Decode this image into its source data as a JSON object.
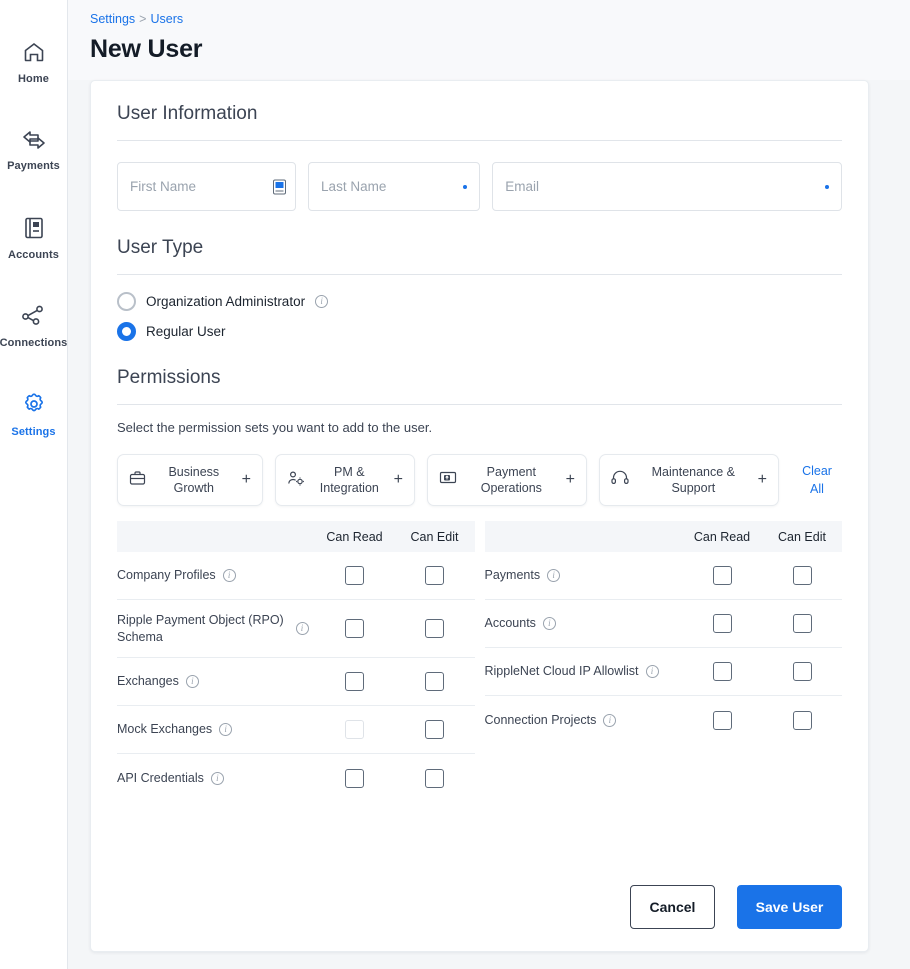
{
  "theme": {
    "accent": "#1a73e8",
    "page_bg": "#f4f6f8",
    "card_bg": "#ffffff",
    "table_head_bg": "#f4f6f9"
  },
  "rail": {
    "items": [
      {
        "label": "Home",
        "icon": "home-icon",
        "active": false
      },
      {
        "label": "Payments",
        "icon": "payments-icon",
        "active": false
      },
      {
        "label": "Accounts",
        "icon": "accounts-icon",
        "active": false
      },
      {
        "label": "Connections",
        "icon": "connections-icon",
        "active": false
      },
      {
        "label": "Settings",
        "icon": "gear-icon",
        "active": true
      }
    ]
  },
  "breadcrumb": {
    "parent": "Settings",
    "separator": ">",
    "current": "Users"
  },
  "page": {
    "title": "New User"
  },
  "user_information": {
    "heading": "User Information",
    "fields": [
      {
        "name": "first-name",
        "placeholder": "First Name",
        "value": "",
        "required_marker": "autofill-icon"
      },
      {
        "name": "last-name",
        "placeholder": "Last Name",
        "value": "",
        "required_marker": "dot"
      },
      {
        "name": "email",
        "placeholder": "Email",
        "value": "",
        "required_marker": "dot"
      }
    ]
  },
  "user_type": {
    "heading": "User Type",
    "options": [
      {
        "label": "Organization Administrator",
        "selected": false,
        "info": true
      },
      {
        "label": "Regular User",
        "selected": true,
        "info": false
      }
    ]
  },
  "permissions": {
    "heading": "Permissions",
    "hint": "Select the permission sets you want to add to the user.",
    "clear_all": "Clear\nAll",
    "clear_all_line1": "Clear",
    "clear_all_line2": "All",
    "sets": [
      {
        "label": "Business Growth",
        "line1": "Business",
        "line2": "Growth",
        "icon": "briefcase-icon",
        "action": "+"
      },
      {
        "label": "PM & Integration",
        "line1": "PM &",
        "line2": "Integration",
        "icon": "person-gear-icon",
        "action": "+"
      },
      {
        "label": "Payment Operations",
        "line1": "Payment",
        "line2": "Operations",
        "icon": "money-card-icon",
        "action": "+"
      },
      {
        "label": "Maintenance & Support",
        "line1": "Maintenance &",
        "line2": "Support",
        "icon": "headset-icon",
        "action": "+"
      }
    ],
    "columns": {
      "name": "",
      "can_read": "Can Read",
      "can_edit": "Can Edit"
    },
    "left_rows": [
      {
        "label": "Company Profiles",
        "info": true,
        "can_read": false,
        "can_edit": false,
        "read_disabled": false
      },
      {
        "label": "Ripple Payment Object (RPO) Schema",
        "info": true,
        "can_read": false,
        "can_edit": false,
        "read_disabled": false
      },
      {
        "label": "Exchanges",
        "info": true,
        "can_read": false,
        "can_edit": false,
        "read_disabled": false
      },
      {
        "label": "Mock Exchanges",
        "info": true,
        "can_read": false,
        "can_edit": false,
        "read_disabled": true
      },
      {
        "label": "API Credentials",
        "info": true,
        "can_read": false,
        "can_edit": false,
        "read_disabled": false
      }
    ],
    "right_rows": [
      {
        "label": "Payments",
        "info": true,
        "can_read": false,
        "can_edit": false,
        "read_disabled": false
      },
      {
        "label": "Accounts",
        "info": true,
        "can_read": false,
        "can_edit": false,
        "read_disabled": false
      },
      {
        "label": "RippleNet Cloud IP Allowlist",
        "info": true,
        "can_read": false,
        "can_edit": false,
        "read_disabled": false
      },
      {
        "label": "Connection Projects",
        "info": true,
        "can_read": false,
        "can_edit": false,
        "read_disabled": false
      }
    ]
  },
  "footer": {
    "cancel": "Cancel",
    "save": "Save User"
  }
}
